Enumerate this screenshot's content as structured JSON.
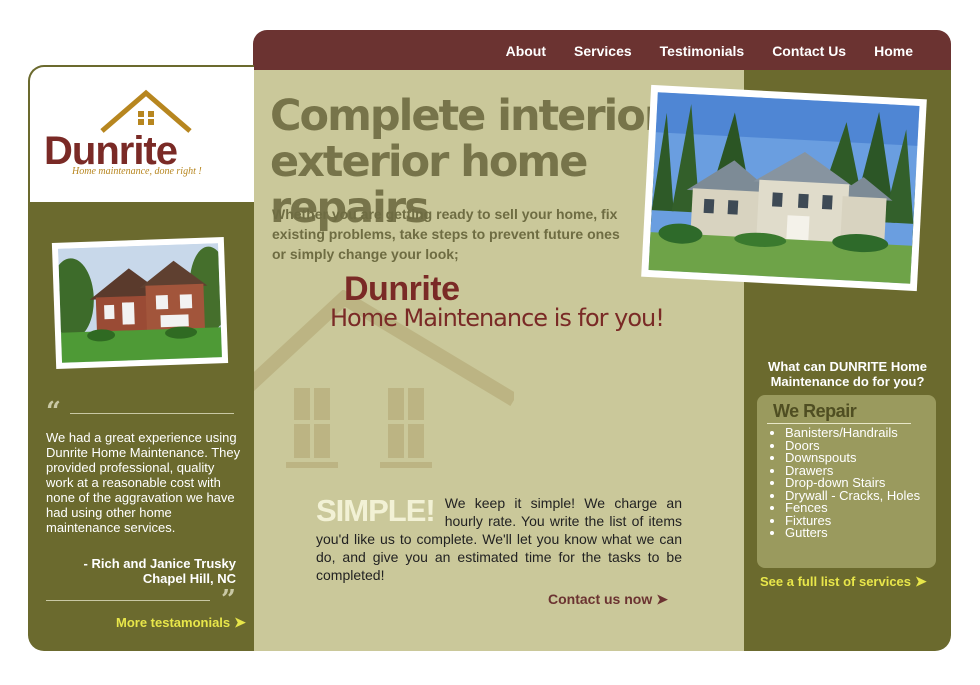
{
  "nav": {
    "items": [
      "About",
      "Services",
      "Testimonials",
      "Contact Us",
      "Home"
    ]
  },
  "logo": {
    "word": "Dunrite",
    "tagline": "Home maintenance, done right !"
  },
  "testimonial": {
    "text": "We had a great experience using Dunrite Home Maintenance. They provided professional, quality work at a reasonable cost with none of the aggravation we have had using other home maintenance services.",
    "author": "- Rich and Janice Trusky",
    "location": "Chapel Hill, NC",
    "more_label": "More testamonials"
  },
  "hero": {
    "headline_line1": "Complete interior",
    "amp": "&",
    "headline_line2": "exterior home repairs",
    "intro": "Whether you are getting ready to sell your home, fix existing problems, take steps to prevent future ones or simply change your look;",
    "brand": "Dunrite",
    "brand_sub": "Home Maintenance is for you!",
    "simple_heading": "SIMPLE!",
    "simple_text": "We keep it simple! We charge an hourly rate. You write the list of items you'd like us to complete. We'll let you know what we can do, and give you an estimated time for the tasks to be completed!",
    "contact_label": "Contact us now"
  },
  "services": {
    "question": "What can DUNRITE Home Maintenance do for you?",
    "title": "We Repair",
    "items": [
      "Banisters/Handrails",
      "Doors",
      "Downspouts",
      "Drawers",
      "Drop-down Stairs",
      "Drywall - Cracks, Holes",
      "Fences",
      "Fixtures",
      "Gutters"
    ],
    "see_label": "See a full list of services"
  },
  "colors": {
    "maroon": "#6b3331",
    "olive": "#6b6a2e",
    "khaki": "#cac89a",
    "yellow_link": "#e8e64a",
    "brand_red": "#7a2a26"
  }
}
